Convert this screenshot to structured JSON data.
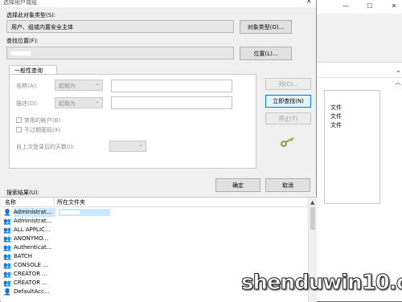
{
  "dialog": {
    "title": "选择用户或组",
    "close_glyph": "×",
    "object_type_label": "选择此对象类型(S):",
    "object_type_value": "用户、组或内置安全主体",
    "object_types_button": "对象类型(O)...",
    "location_label": "查找位置(F):",
    "location_button": "位置(L)...",
    "tab_label": "一般性查询",
    "name_label": "名称(A):",
    "desc_label": "描述(D):",
    "starts_with": "起始为",
    "columns_button": "列(C)...",
    "find_now_button": "立即查找(N)",
    "stop_button": "停止(T)",
    "disabled_accounts": "禁用的帐户(B)",
    "non_expiring": "不过期密码(X)",
    "days_since_logon": "自上次登录后的天数(I):",
    "ok_button": "确定",
    "cancel_button": "取消",
    "results_label": "搜索结果(U):",
    "col_name": "名称",
    "col_folder": "所在文件夹"
  },
  "results": [
    {
      "name": "Administrat..."
    },
    {
      "name": "Administrat..."
    },
    {
      "name": "ALL APPLIC..."
    },
    {
      "name": "ANONYMO..."
    },
    {
      "name": "Authenticat..."
    },
    {
      "name": "BATCH"
    },
    {
      "name": "CONSOLE ..."
    },
    {
      "name": "CREATOR ..."
    },
    {
      "name": "CREATOR ..."
    },
    {
      "name": "DefaultAcc..."
    }
  ],
  "background": {
    "file_1": "文件",
    "file_2": "文件",
    "file_3": "文件"
  },
  "watermark": "shenduwin10.com",
  "colors": {
    "dialog_bg": "#f0f0f0",
    "selection": "#cce8ff",
    "focus_border": "#0078d7"
  }
}
